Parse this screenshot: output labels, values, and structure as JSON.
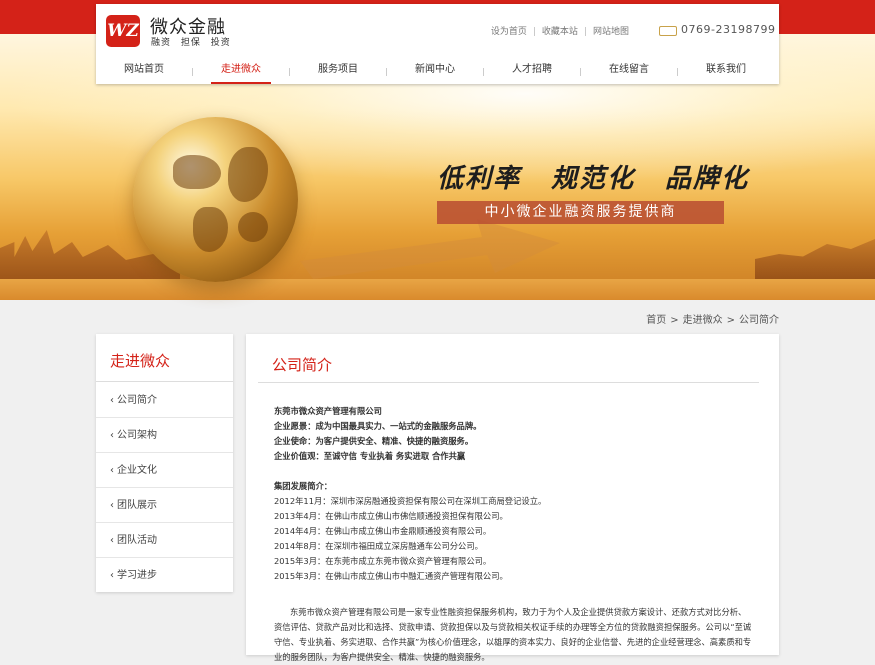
{
  "header": {
    "logo_mark": "WZ",
    "logo_name": "微众金融",
    "logo_sub": "融资 担保 投资",
    "top_links": [
      "设为首页",
      "收藏本站",
      "网站地图"
    ],
    "phone": "0769-23198799"
  },
  "nav": {
    "items": [
      "网站首页",
      "走进微众",
      "服务项目",
      "新闻中心",
      "人才招聘",
      "在线留言",
      "联系我们"
    ],
    "active_index": 1
  },
  "banner": {
    "slogan": [
      "低利率",
      "规范化",
      "品牌化"
    ],
    "tagline": "中小微企业融资服务提供商"
  },
  "breadcrumb": [
    "首页",
    "走进微众",
    "公司简介"
  ],
  "sidebar": {
    "title": "走进微众",
    "items": [
      "公司简介",
      "公司架构",
      "企业文化",
      "团队展示",
      "团队活动",
      "学习进步"
    ]
  },
  "main": {
    "title": "公司简介",
    "company": "东莞市微众资产管理有限公司",
    "vision": "企业愿景：成为中国最具实力、一站式的金融服务品牌。",
    "mission": "企业使命：为客户提供安全、精准、快捷的融资服务。",
    "values": "企业价值观：至诚守信  专业执着  务实进取  合作共赢",
    "history_title": "集团发展简介：",
    "history": [
      "2012年11月：深圳市深房融通投资担保有限公司在深圳工商局登记设立。",
      "2013年4月：在佛山市成立佛山市佛信顺通投资担保有限公司。",
      "2014年4月：在佛山市成立佛山市金鼎顺通投资有限公司。",
      "2014年8月：在深圳市福田成立深房融通车公司分公司。",
      "2015年3月：在东莞市成立东莞市微众资产管理有限公司。",
      "2015年3月：在佛山市成立佛山市中融汇通资产管理有限公司。"
    ],
    "paragraph": "东莞市微众资产管理有限公司是一家专业性融资担保服务机构，致力于为个人及企业提供贷款方案设计、还款方式对比分析、资信评估、贷款产品对比和选择、贷款申请、贷款担保以及与贷款相关权证手续的办理等全方位的贷款融资担保服务。公司以“至诚守信、专业执着、务实进取、合作共赢”为核心价值理念，以雄厚的资本实力、良好的企业信誉、先进的企业经营理念、高素质和专业的服务团队，为客户提供安全、精准、快捷的融资服务。"
  },
  "colors": {
    "brand_red": "#d42218",
    "banner_gold": "#f2b955"
  }
}
